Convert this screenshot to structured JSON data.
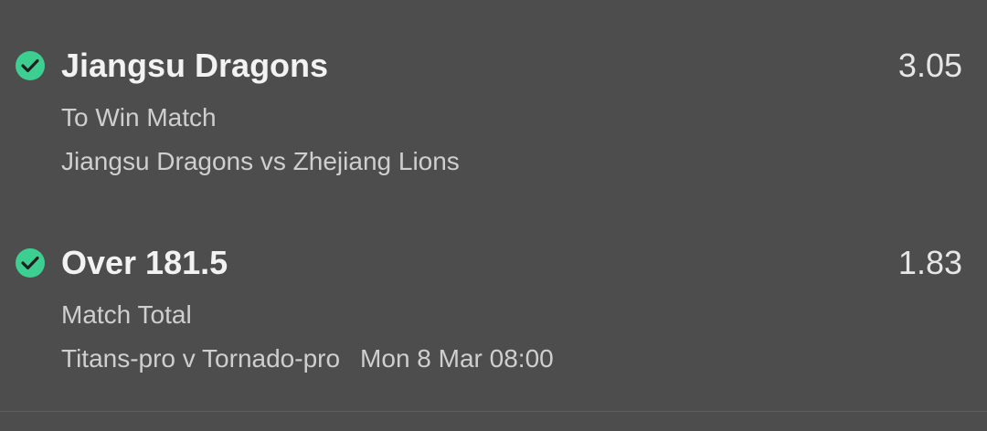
{
  "colors": {
    "accent": "#3ccf91",
    "background": "#4d4d4d"
  },
  "selections": [
    {
      "status_icon": "check-circle-icon",
      "title": "Jiangsu Dragons",
      "odds": "3.05",
      "market": "To Win Match",
      "event": "Jiangsu Dragons vs Zhejiang Lions",
      "time": ""
    },
    {
      "status_icon": "check-circle-icon",
      "title": "Over 181.5",
      "odds": "1.83",
      "market": "Match Total",
      "event": "Titans-pro v Tornado-pro",
      "time": "Mon 8 Mar 08:00"
    }
  ]
}
